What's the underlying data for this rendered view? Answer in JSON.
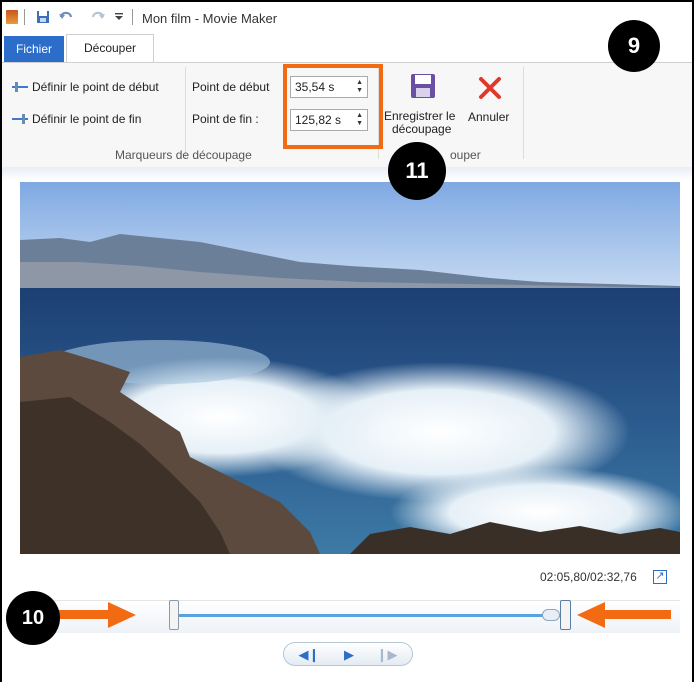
{
  "window": {
    "title": "Mon film - Movie Maker"
  },
  "tabs": [
    {
      "label": "Fichier"
    },
    {
      "label": "Découper"
    }
  ],
  "ribbon": {
    "set_start": "Définir le point de début",
    "set_end": "Définir le point de fin",
    "start_label": "Point de début",
    "end_label": "Point de fin :",
    "start_value": "35,54 s",
    "end_value": "125,82 s",
    "group_markers": "Marqueurs de découpage",
    "save_trim_line1": "Enregistrer le",
    "save_trim_line2": "découpage",
    "cancel": "Annuler",
    "group_trim_partial": "ouper"
  },
  "annotations": {
    "badge_9": "9",
    "badge_10": "10",
    "badge_11": "11"
  },
  "player": {
    "timecode": "02:05,80/02:32,76",
    "start_fraction": 0.2335,
    "end_fraction": 0.8261
  },
  "colors": {
    "accent": "#2b6dc9",
    "highlight": "#f26b12",
    "arrow": "#f26b12",
    "cancel": "#e0392b"
  },
  "icons": [
    "quick-save-icon",
    "undo-icon",
    "redo-icon",
    "customize-toolbar-icon",
    "save-trim-icon",
    "cancel-icon",
    "expand-icon",
    "previous-frame-icon",
    "play-icon",
    "next-frame-icon"
  ]
}
